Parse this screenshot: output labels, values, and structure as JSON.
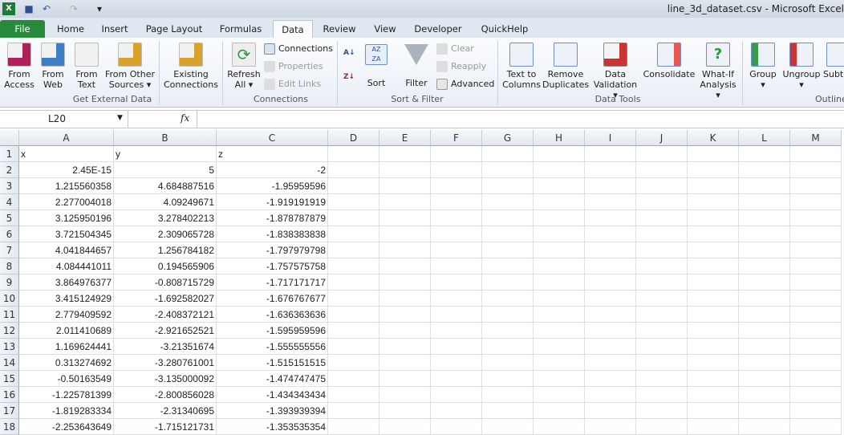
{
  "title": "line_3d_dataset.csv - Microsoft Excel",
  "tabs": [
    "File",
    "Home",
    "Insert",
    "Page Layout",
    "Formulas",
    "Data",
    "Review",
    "View",
    "Developer",
    "QuickHelp"
  ],
  "active_tab": "Data",
  "ribbon": {
    "from_access": [
      "From",
      "Access"
    ],
    "from_web": [
      "From",
      "Web"
    ],
    "from_text": [
      "From",
      "Text"
    ],
    "from_other": [
      "From Other",
      "Sources ▾"
    ],
    "existing": [
      "Existing",
      "Connections"
    ],
    "group_external": "Get External Data",
    "refresh": [
      "Refresh",
      "All ▾"
    ],
    "connections": "Connections",
    "properties": "Properties",
    "edit_links": "Edit Links",
    "group_connections": "Connections",
    "sort": "Sort",
    "filter": "Filter",
    "clear": "Clear",
    "reapply": "Reapply",
    "advanced": "Advanced",
    "group_sort": "Sort & Filter",
    "text_to_columns": [
      "Text to",
      "Columns"
    ],
    "remove_duplicates": [
      "Remove",
      "Duplicates"
    ],
    "data_validation": [
      "Data",
      "Validation ▾"
    ],
    "consolidate": [
      "Consolidate",
      ""
    ],
    "what_if": [
      "What-If",
      "Analysis ▾"
    ],
    "group_tools": "Data Tools",
    "group": [
      "Group",
      "▾"
    ],
    "ungroup": [
      "Ungroup",
      "▾"
    ],
    "subtotal": [
      "Subt",
      ""
    ],
    "group_outline": "Outline"
  },
  "name_box": "L20",
  "fx": "fx",
  "formula": "",
  "columns": [
    "A",
    "B",
    "C",
    "D",
    "E",
    "F",
    "G",
    "H",
    "I",
    "J",
    "K",
    "L",
    "M"
  ],
  "rows": [
    [
      "x",
      "y",
      "z"
    ],
    [
      "2.45E-15",
      "5",
      "-2"
    ],
    [
      "1.215560358",
      "4.684887516",
      "-1.95959596"
    ],
    [
      "2.277004018",
      "4.09249671",
      "-1.919191919"
    ],
    [
      "3.125950196",
      "3.278402213",
      "-1.878787879"
    ],
    [
      "3.721504345",
      "2.309065728",
      "-1.838383838"
    ],
    [
      "4.041844657",
      "1.256784182",
      "-1.797979798"
    ],
    [
      "4.084441011",
      "0.194565906",
      "-1.757575758"
    ],
    [
      "3.864976377",
      "-0.808715729",
      "-1.717171717"
    ],
    [
      "3.415124929",
      "-1.692582027",
      "-1.676767677"
    ],
    [
      "2.779409592",
      "-2.408372121",
      "-1.636363636"
    ],
    [
      "2.011410689",
      "-2.921652521",
      "-1.595959596"
    ],
    [
      "1.169624441",
      "-3.21351674",
      "-1.555555556"
    ],
    [
      "0.313274692",
      "-3.280761001",
      "-1.515151515"
    ],
    [
      "-0.50163549",
      "-3.135000092",
      "-1.474747475"
    ],
    [
      "-1.225781399",
      "-2.800856028",
      "-1.434343434"
    ],
    [
      "-1.819283334",
      "-2.31340695",
      "-1.393939394"
    ],
    [
      "-2.253643649",
      "-1.715121731",
      "-1.353535354"
    ]
  ]
}
